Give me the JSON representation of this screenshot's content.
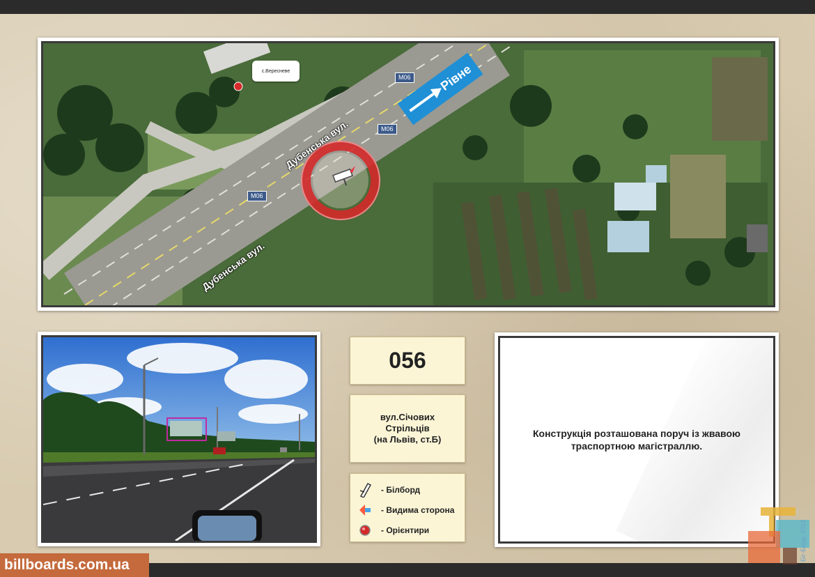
{
  "map": {
    "village_label": "с.Вересневе",
    "road_code_1": "M06",
    "road_code_2": "M06",
    "road_code_3": "M06",
    "street_label_1": "Дубенська вул.",
    "street_label_2": "Дубенська вул.",
    "direction_label": "Рівне"
  },
  "board": {
    "code": "056",
    "address_line1": "вул.Січових",
    "address_line2": "Стрільців",
    "address_line3": "(на Львів, ст.Б)"
  },
  "legend": {
    "items": [
      {
        "icon": "billboard-icon",
        "label": "- Білборд"
      },
      {
        "icon": "visible-side-icon",
        "label": "- Видима сторона"
      },
      {
        "icon": "landmark-icon",
        "label": "- Орієнтири"
      }
    ]
  },
  "description": {
    "line1": "Конструкція розташована поруч із жвавою",
    "line2": "траспортною магістраллю."
  },
  "brand": {
    "site": "billboards.com.ua",
    "stamp_text": "Біг-Борд, 2013"
  },
  "colors": {
    "direction_arrow": "#1f8fd6",
    "marker_ring": "#d42a2a",
    "brand_bg": "#c46a3c",
    "paper": "#d8cbb0"
  }
}
